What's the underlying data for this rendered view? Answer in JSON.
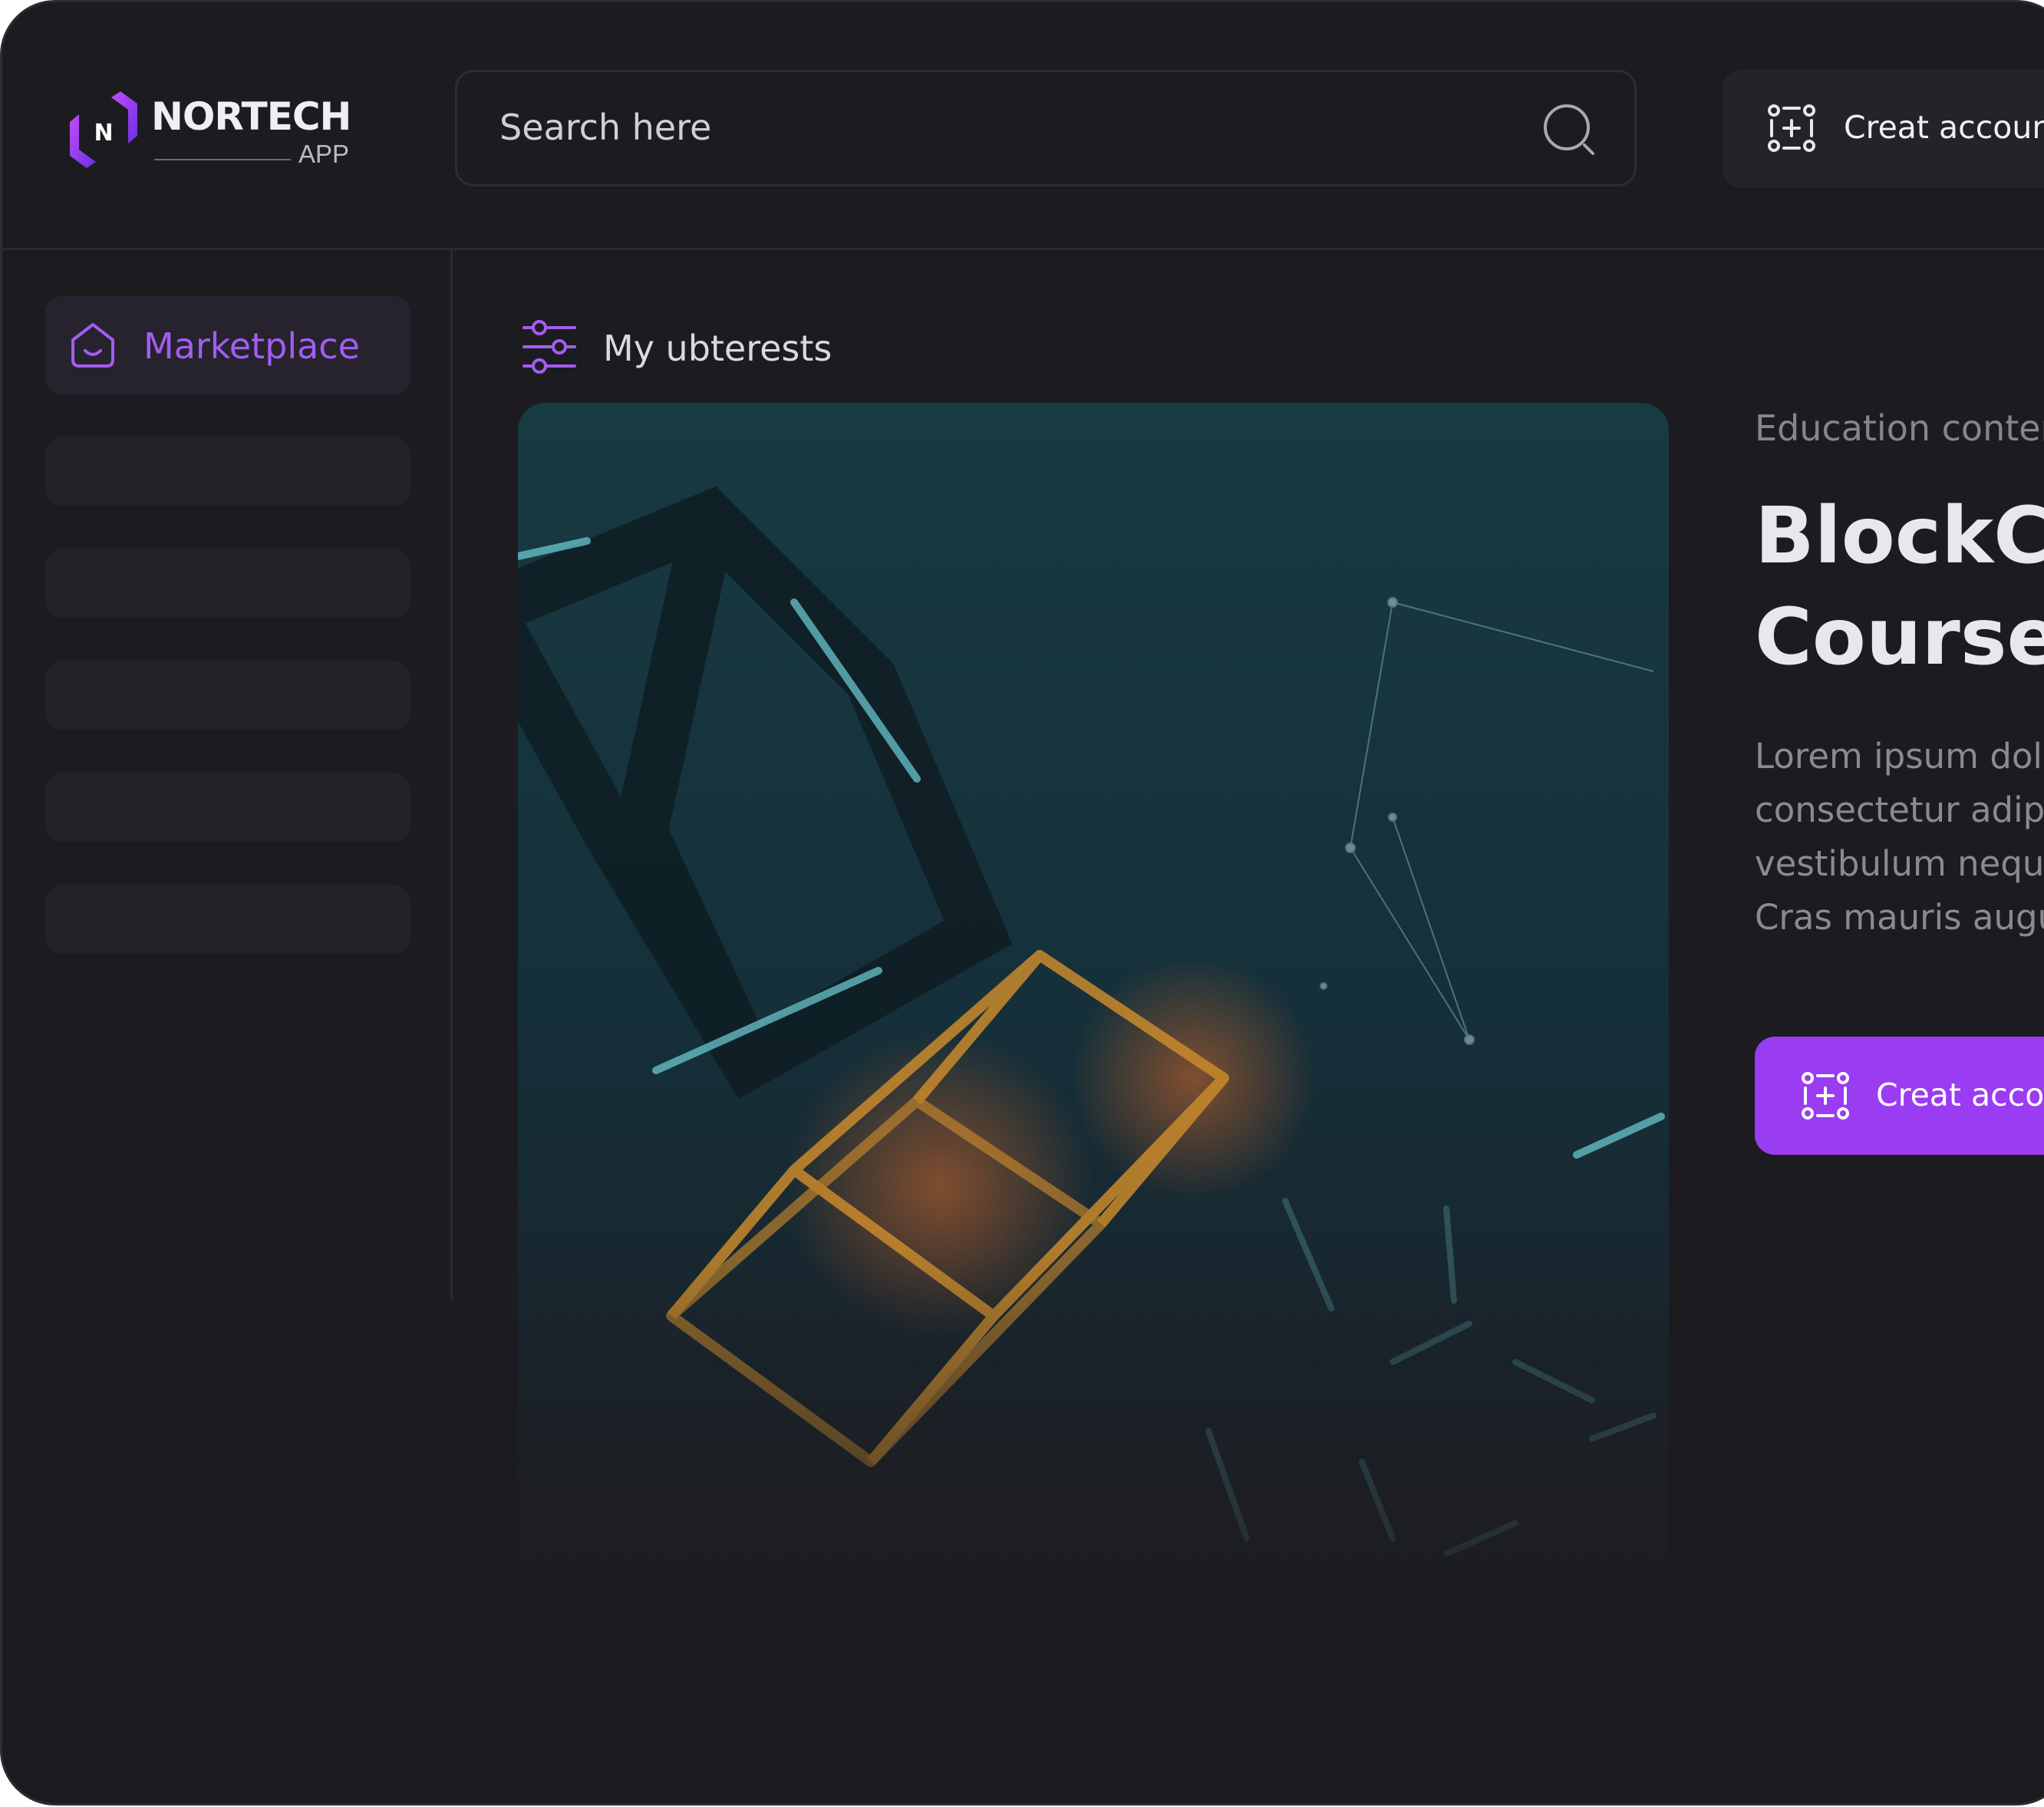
{
  "brand": {
    "name": "NORTECH",
    "sub": "APP",
    "accent": "#9a3cf2"
  },
  "search": {
    "placeholder": "Search here",
    "icon": "search-icon"
  },
  "header_button": {
    "label": "Creat account",
    "icon": "add-account-icon"
  },
  "sidebar": {
    "active_item": {
      "label": "Marketplace",
      "icon": "home-icon"
    },
    "placeholder_items": 5
  },
  "main": {
    "filter": {
      "label": "My ubterests",
      "icon": "filter-sliders-icon"
    },
    "card": {
      "image": "blockchain-cubes-image",
      "category": "Education content",
      "title": "BlockChain Course",
      "description": "Lorem ipsum dolor sit amet, consectetur adipiscing elit. Donec vestibulum neque sed lacus placerat. Cras mauris augue, in pellentesque nisi",
      "cta_label": "Creat account",
      "cta_icon": "add-account-icon"
    }
  }
}
